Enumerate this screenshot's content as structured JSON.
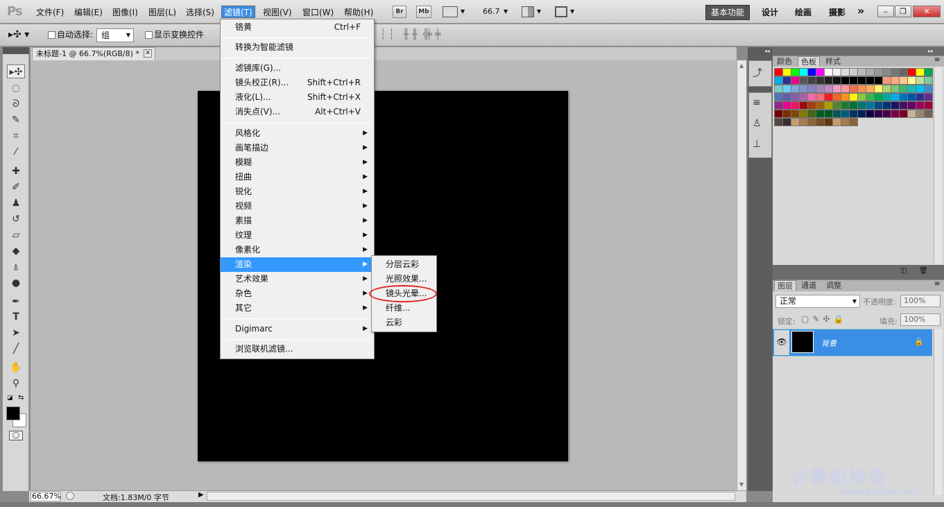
{
  "app": {
    "logo": "Ps"
  },
  "menubar": {
    "items": [
      "文件(F)",
      "编辑(E)",
      "图像(I)",
      "图层(L)",
      "选择(S)",
      "滤镜(T)",
      "视图(V)",
      "窗口(W)",
      "帮助(H)"
    ],
    "bridge_btn": "Br",
    "minibridge_btn": "Mb",
    "zoom_value": "66.7",
    "workspaces": [
      "基本功能",
      "设计",
      "绘画",
      "摄影"
    ],
    "more": "»"
  },
  "options": {
    "auto_select_label": "自动选择:",
    "auto_select_value": "组",
    "show_transform_label": "显示变换控件"
  },
  "document": {
    "tab_title": "未标题-1 @ 66.7%(RGB/8) *",
    "canvas_color": "#000000"
  },
  "status": {
    "zoom": "66.67%",
    "doc_info": "文档:1.83M/0 字节"
  },
  "filter_menu": {
    "items": [
      {
        "label": "铬黄",
        "shortcut": "Ctrl+F"
      },
      {
        "label": "转换为智能滤镜",
        "shortcut": ""
      },
      {
        "label": "滤镜库(G)...",
        "shortcut": ""
      },
      {
        "label": "镜头校正(R)...",
        "shortcut": "Shift+Ctrl+R"
      },
      {
        "label": "液化(L)...",
        "shortcut": "Shift+Ctrl+X"
      },
      {
        "label": "消失点(V)...",
        "shortcut": "Alt+Ctrl+V"
      },
      {
        "label": "风格化",
        "submenu": true
      },
      {
        "label": "画笔描边",
        "submenu": true
      },
      {
        "label": "模糊",
        "submenu": true
      },
      {
        "label": "扭曲",
        "submenu": true
      },
      {
        "label": "锐化",
        "submenu": true
      },
      {
        "label": "视频",
        "submenu": true
      },
      {
        "label": "素描",
        "submenu": true
      },
      {
        "label": "纹理",
        "submenu": true
      },
      {
        "label": "像素化",
        "submenu": true
      },
      {
        "label": "渲染",
        "submenu": true,
        "highlighted": true
      },
      {
        "label": "艺术效果",
        "submenu": true
      },
      {
        "label": "杂色",
        "submenu": true
      },
      {
        "label": "其它",
        "submenu": true
      },
      {
        "label": "Digimarc",
        "submenu": true
      },
      {
        "label": "浏览联机滤镜...",
        "shortcut": ""
      }
    ]
  },
  "render_submenu": {
    "items": [
      "分层云彩",
      "光照效果...",
      "镜头光晕...",
      "纤维...",
      "云彩"
    ],
    "circled_item": "镜头光晕..."
  },
  "panels": {
    "color_tabs": [
      "颜色",
      "色板",
      "样式"
    ],
    "color_active_tab": "色板",
    "layer_tabs": [
      "图层",
      "通道",
      "调整"
    ],
    "layer_active_tab": "图层",
    "blend_mode": "正常",
    "opacity_label": "不透明度:",
    "opacity_value": "100%",
    "lock_label": "锁定:",
    "fill_label": "填充:",
    "fill_value": "100%",
    "layer_name": "背景"
  },
  "swatches": [
    "#ff0000",
    "#ffff00",
    "#00ff00",
    "#00ffff",
    "#0000ff",
    "#ff00ff",
    "#ffffff",
    "#eeeeee",
    "#dddddd",
    "#cccccc",
    "#bbbbbb",
    "#aaaaaa",
    "#999999",
    "#888888",
    "#777777",
    "#666666",
    "#ff0000",
    "#ffff00",
    "#00a651",
    "#00aeef",
    "#2e3192",
    "#ec008c",
    "#555555",
    "#444444",
    "#333333",
    "#222222",
    "#111111",
    "#000000",
    "#000000",
    "#000000",
    "#000000",
    "#000000",
    "#f7977a",
    "#f9ad81",
    "#fdc68a",
    "#fff79a",
    "#c4df9b",
    "#82ca9c",
    "#7bcdc8",
    "#6ecff6",
    "#7ea7d8",
    "#8493ca",
    "#8882be",
    "#a187be",
    "#bc8cbf",
    "#f49ac2",
    "#f6989d",
    "#f26c4f",
    "#f68e55",
    "#fbaf5c",
    "#fff467",
    "#acd372",
    "#7cc576",
    "#3bb878",
    "#1abbb4",
    "#00bff3",
    "#438ccb",
    "#5574b9",
    "#605ca8",
    "#855fa8",
    "#a763a8",
    "#f06eaa",
    "#f26d7d",
    "#ed1c24",
    "#f26522",
    "#f7941d",
    "#fff200",
    "#8dc73f",
    "#39b54a",
    "#00a651",
    "#00a99d",
    "#00aeef",
    "#0072bc",
    "#0054a6",
    "#2e3192",
    "#662d91",
    "#92278f",
    "#ec008c",
    "#ed145b",
    "#9e0b0f",
    "#a0410d",
    "#a36209",
    "#aba000",
    "#598527",
    "#1a7b30",
    "#007236",
    "#00746b",
    "#0076a3",
    "#004b80",
    "#003471",
    "#1b1464",
    "#440e62",
    "#630460",
    "#9e005d",
    "#9e0039",
    "#790000",
    "#7b2e00",
    "#7d4900",
    "#827b00",
    "#406618",
    "#005e20",
    "#005826",
    "#005952",
    "#005b7f",
    "#003663",
    "#002157",
    "#0d004c",
    "#32004b",
    "#4b0049",
    "#7b0046",
    "#7a0026",
    "#c7b299",
    "#998675",
    "#736357",
    "#534741",
    "#37302d",
    "#c69c6d",
    "#a67c52",
    "#8c6239",
    "#754c24",
    "#603913",
    "#c69c6d",
    "#a67c52",
    "#8c6239"
  ],
  "watermark": {
    "text": "计算机协会",
    "url": "www.gejixie.com"
  }
}
